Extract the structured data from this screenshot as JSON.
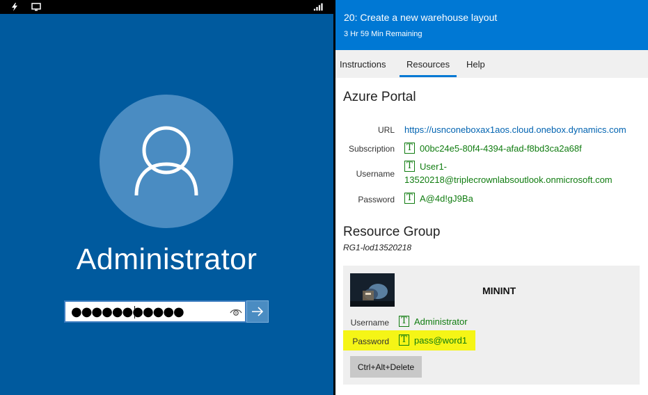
{
  "vm": {
    "status_icons": [
      "charging-icon",
      "monitor-icon",
      "signal-icon"
    ],
    "username": "Administrator",
    "password_masked": "●●●●●●●●●●●",
    "reveal_icon": "eye-icon",
    "submit_icon": "arrow-right-icon"
  },
  "lab": {
    "title": "20: Create a new warehouse layout",
    "time_remaining": "3 Hr 59 Min Remaining",
    "tabs": [
      {
        "label": "Instructions",
        "active": false
      },
      {
        "label": "Resources",
        "active": true
      },
      {
        "label": "Help",
        "active": false
      }
    ],
    "azure": {
      "title": "Azure Portal",
      "url_label": "URL",
      "url": "https://usnconeboxax1aos.cloud.onebox.dynamics.com",
      "subscription_label": "Subscription",
      "subscription": "00bc24e5-80f4-4394-afad-f8bd3ca2a68f",
      "username_label": "Username",
      "username_line1": "User1-",
      "username_line2": "13520218@triplecrownlabsoutlook.onmicrosoft.com",
      "password_label": "Password",
      "password": "A@4d!gJ9Ba",
      "type_glyph": "T"
    },
    "resource_group": {
      "title": "Resource Group",
      "name": "RG1-lod13520218"
    },
    "vm_card": {
      "name": "MININT",
      "username_label": "Username",
      "username": "Administrator",
      "password_label": "Password",
      "password": "pass@word1",
      "cad_label": "Ctrl+Alt+Delete"
    }
  },
  "colors": {
    "vm_background": "#005a9e",
    "header_blue": "#0078d4",
    "value_green": "#107c10",
    "link_blue": "#0063b1",
    "highlight_yellow": "#f5f516"
  }
}
